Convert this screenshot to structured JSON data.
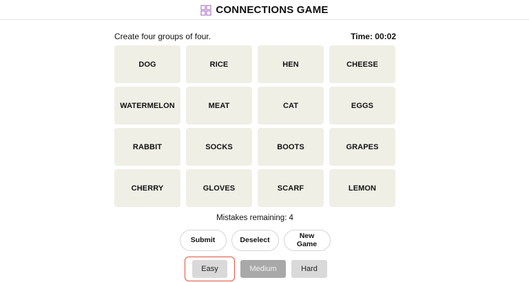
{
  "header": {
    "title": "CONNECTIONS GAME",
    "logo_icon": "grid-icon",
    "logo_color": "#b784c9"
  },
  "instructions": "Create four groups of four.",
  "timer": "Time: 00:02",
  "tiles": [
    "DOG",
    "RICE",
    "HEN",
    "CHEESE",
    "WATERMELON",
    "MEAT",
    "CAT",
    "EGGS",
    "RABBIT",
    "SOCKS",
    "BOOTS",
    "GRAPES",
    "CHERRY",
    "GLOVES",
    "SCARF",
    "LEMON"
  ],
  "mistakes": "Mistakes remaining: 4",
  "actions": {
    "submit": "Submit",
    "deselect": "Deselect",
    "new_game": "New Game"
  },
  "difficulty": {
    "easy": "Easy",
    "medium": "Medium",
    "hard": "Hard",
    "selected": "Easy",
    "highlight_color": "#e0523a"
  }
}
